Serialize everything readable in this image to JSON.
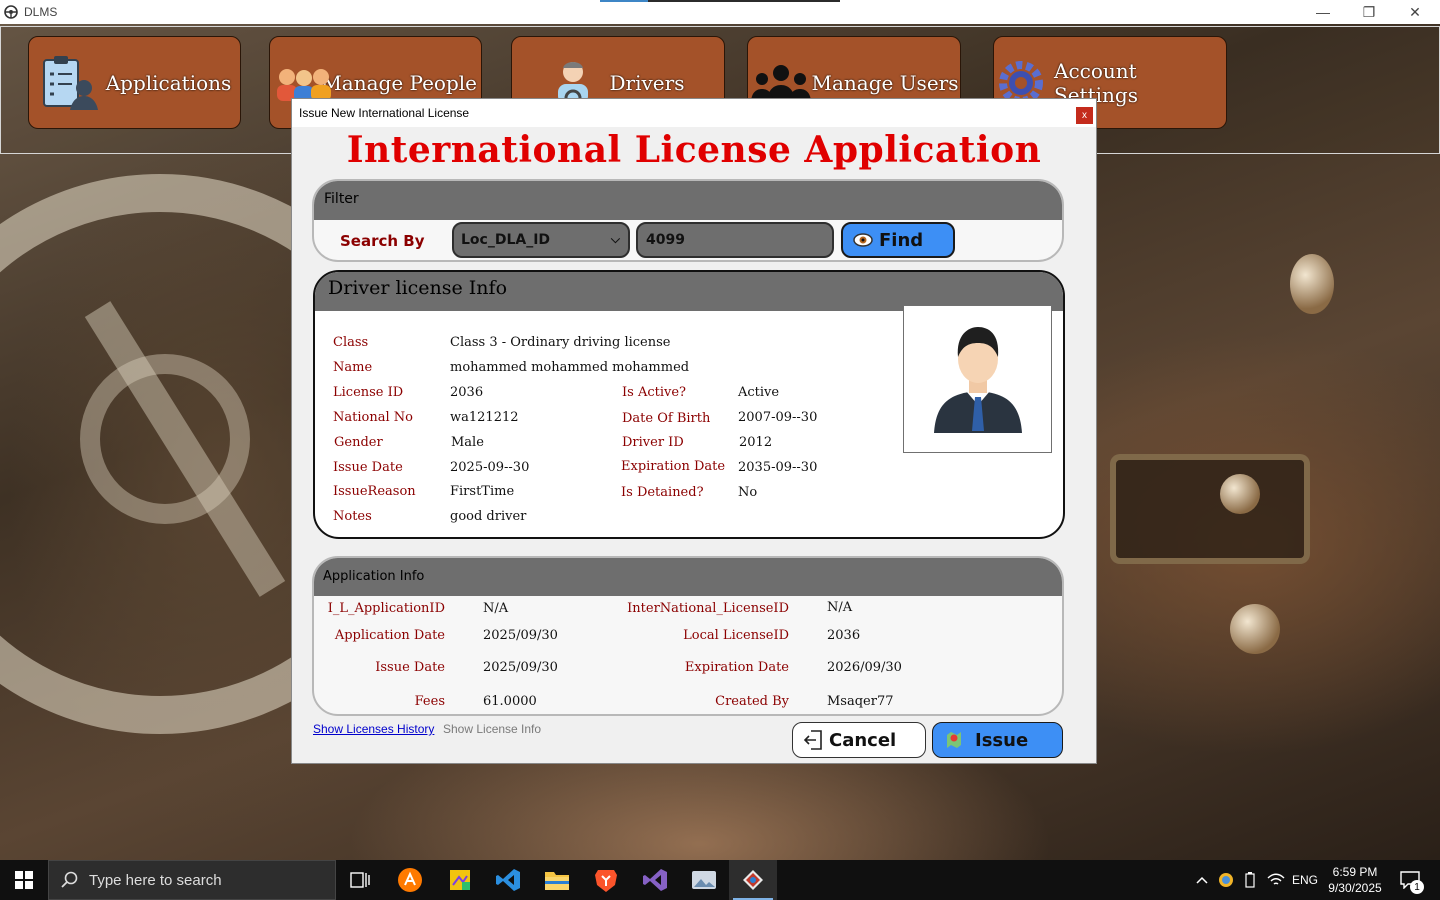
{
  "window": {
    "title": "DLMS"
  },
  "nav": [
    {
      "label": "Applications",
      "icon": "clipboard-user-icon"
    },
    {
      "label": "Manage People",
      "icon": "people-group-icon"
    },
    {
      "label": "Drivers",
      "icon": "driver-icon"
    },
    {
      "label": "Manage Users",
      "icon": "users-icon"
    },
    {
      "label": "Account Settings",
      "icon": "gear-icon"
    }
  ],
  "dialog": {
    "title": "Issue New International License",
    "close": "x",
    "heading": "International License Application",
    "filter": {
      "title": "Filter",
      "search_by_label": "Search By",
      "search_by_value": "Loc_DLA_ID",
      "search_value": "4099",
      "find_label": "Find"
    },
    "license_info": {
      "title": "Driver license Info",
      "labels": {
        "class": "Class",
        "name": "Name",
        "license_id": "License ID",
        "national_no": "National No",
        "gender": "Gender",
        "issue_date": "Issue Date",
        "issue_reason": "IssueReason",
        "notes": "Notes",
        "is_active": "Is Active?",
        "date_of_birth": "Date Of Birth",
        "driver_id": "Driver ID",
        "expiration_date": "Expiration Date",
        "is_detained": "Is Detained?"
      },
      "values": {
        "class": "Class 3 - Ordinary driving license",
        "name": "mohammed mohammed mohammed",
        "license_id": "2036",
        "national_no": "wa121212",
        "gender": "Male",
        "issue_date": "2025-09--30",
        "issue_reason": "FirstTime",
        "notes": "good driver",
        "is_active": "Active",
        "date_of_birth": "2007-09--30",
        "driver_id": "2012",
        "expiration_date": "2035-09--30",
        "is_detained": "No"
      }
    },
    "application_info": {
      "title": "Application Info",
      "labels": {
        "il_application_id": "I_L_ApplicationID",
        "application_date": "Application Date",
        "issue_date": "Issue Date",
        "fees": "Fees",
        "international_license_id": "InterNational_LicenseID",
        "local_license_id": "Local LicenseID",
        "expiration_date": "Expiration Date",
        "created_by": "Created By"
      },
      "values": {
        "il_application_id": "N/A",
        "application_date": "2025/09/30",
        "issue_date": "2025/09/30",
        "fees": "61.0000",
        "international_license_id": "N/A",
        "local_license_id": "2036",
        "expiration_date": "2026/09/30",
        "created_by": "Msaqer77"
      }
    },
    "links": {
      "history": "Show Licenses History",
      "info": "Show License Info"
    },
    "buttons": {
      "cancel": "Cancel",
      "issue": "Issue"
    }
  },
  "taskbar": {
    "search_placeholder": "Type here to search",
    "apps": [
      "task-view-icon",
      "avast-icon",
      "whiteboard-icon",
      "vscode-icon",
      "file-explorer-icon",
      "brave-icon",
      "visual-studio-icon",
      "photos-icon",
      "dlms-app-icon"
    ],
    "tray": {
      "language": "ENG",
      "time": "6:59 PM",
      "date": "9/30/2025",
      "notifications": "1"
    }
  },
  "colors": {
    "nav_button": "#a45229",
    "heading": "#e00000",
    "label": "#8b0000",
    "find_button": "#3d8ff5",
    "issue_button": "#3d8ff5",
    "section_header": "#6e6e6e"
  }
}
